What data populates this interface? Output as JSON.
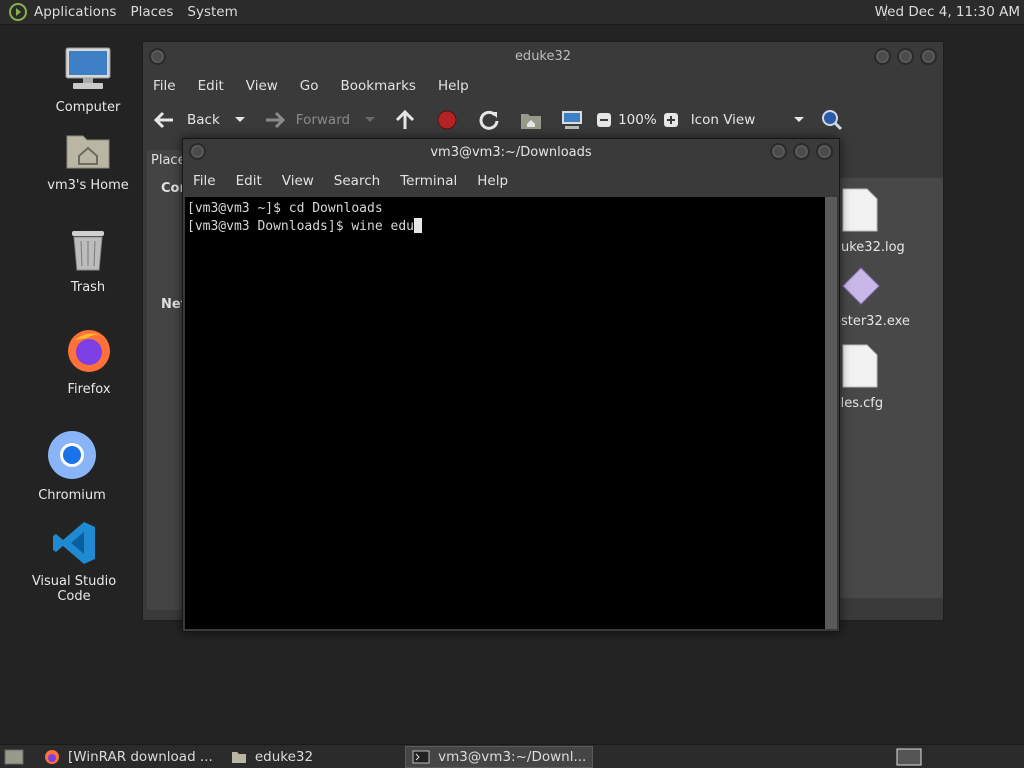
{
  "top_panel": {
    "menus": [
      "Applications",
      "Places",
      "System"
    ],
    "clock": "Wed Dec  4, 11:30 AM"
  },
  "desktop": {
    "icons": [
      {
        "label": "Computer",
        "icon": "computer-icon"
      },
      {
        "label": "vm3's Home",
        "icon": "home-folder-icon"
      },
      {
        "label": "Trash",
        "icon": "trash-icon"
      },
      {
        "label": "Firefox",
        "icon": "firefox-icon"
      },
      {
        "label": "Chromium",
        "icon": "chromium-icon"
      },
      {
        "label": "Visual Studio Code",
        "icon": "vscode-icon"
      }
    ]
  },
  "file_manager": {
    "title": "eduke32",
    "menu": [
      "File",
      "Edit",
      "View",
      "Go",
      "Bookmarks",
      "Help"
    ],
    "toolbar": {
      "back": "Back",
      "forward": "Forward",
      "zoom": "100%",
      "view_mode": "Icon View"
    },
    "sidebar": {
      "places_label": "Place",
      "computer_label": "Cor",
      "network_label": "Net"
    },
    "files": [
      "uke32.log",
      "oster32.exe",
      "iles.cfg"
    ]
  },
  "terminal": {
    "title": "vm3@vm3:~/Downloads",
    "menu": [
      "File",
      "Edit",
      "View",
      "Search",
      "Terminal",
      "Help"
    ],
    "lines": [
      "[vm3@vm3 ~]$ cd Downloads",
      "[vm3@vm3 Downloads]$ wine edu"
    ]
  },
  "taskbar": {
    "tasks": [
      {
        "label": "[WinRAR download ...",
        "icon": "firefox-icon"
      },
      {
        "label": "eduke32",
        "icon": "folder-icon"
      },
      {
        "label": "vm3@vm3:~/Downl...",
        "icon": "terminal-icon"
      }
    ]
  },
  "colors": {
    "panel_bg": "#2b2b2b",
    "desktop_bg": "#232323",
    "window_bg": "#3a3a3a",
    "terminal_bg": "#000000"
  }
}
